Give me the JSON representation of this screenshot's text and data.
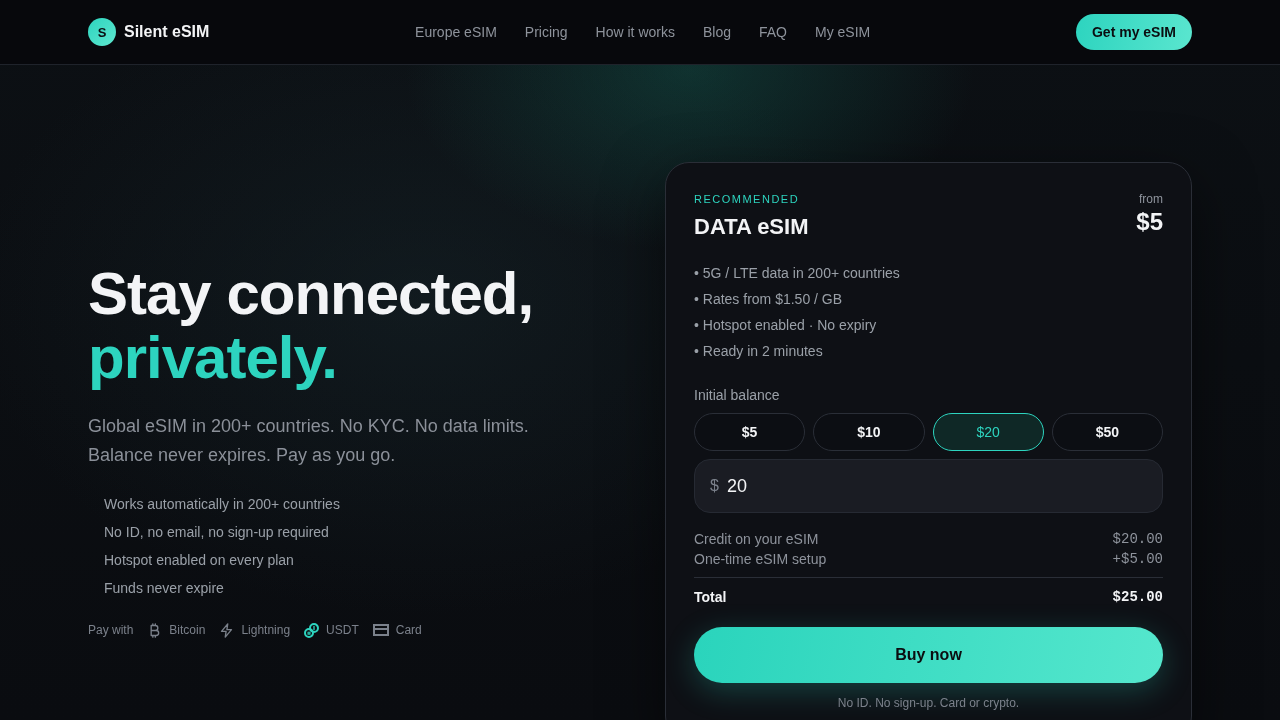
{
  "header": {
    "logo_letter": "S",
    "brand": "Silent eSIM",
    "nav": [
      {
        "label": "Europe eSIM"
      },
      {
        "label": "Pricing"
      },
      {
        "label": "How it works"
      },
      {
        "label": "Blog"
      },
      {
        "label": "FAQ"
      },
      {
        "label": "My eSIM"
      }
    ],
    "cta": "Get my eSIM"
  },
  "hero": {
    "title_line_1": "Stay connected,",
    "title_line_2": "privately.",
    "subtitle_lines": [
      "Global eSIM in 200+ countries. No KYC. No data limits.",
      "Balance never expires. Pay as you go."
    ],
    "features": [
      "Works automatically in 200+ countries",
      "No ID, no email, no sign-up required",
      "Hotspot enabled on every plan",
      "Funds never expire"
    ],
    "pay_with": {
      "label": "Pay with",
      "methods": [
        {
          "kind": "bitcoin",
          "label": "Bitcoin",
          "color": "#7b818b"
        },
        {
          "kind": "lightning",
          "label": "Lightning",
          "color": "#7b818b"
        },
        {
          "kind": "coins",
          "label": "USDT",
          "color": "#2dd4bf"
        },
        {
          "kind": "card",
          "label": "Card",
          "color": "#7b818b"
        }
      ]
    }
  },
  "card": {
    "badge": "RECOMMENDED",
    "title": "DATA eSIM",
    "price_prefix": "from",
    "price": "$5",
    "bullets": [
      "• 5G / LTE data in 200+ countries",
      "• Rates from $1.50 / GB",
      "• Hotspot enabled · No expiry",
      "• Ready in 2 minutes"
    ],
    "balance_label": "Initial balance",
    "amounts": [
      {
        "label": "$5",
        "selected": false
      },
      {
        "label": "$10",
        "selected": false
      },
      {
        "label": "$20",
        "selected": true
      },
      {
        "label": "$50",
        "selected": false
      }
    ],
    "amount_input": {
      "prefix": "$",
      "value": "20"
    },
    "summary": [
      {
        "label": "Credit on your eSIM",
        "value": "$20.00"
      },
      {
        "label": "One-time eSIM setup",
        "value": "+$5.00"
      }
    ],
    "total": {
      "label": "Total",
      "value": "$25.00"
    },
    "buy_button": "Buy now",
    "footnote": "No ID. No sign-up. Card or crypto."
  }
}
